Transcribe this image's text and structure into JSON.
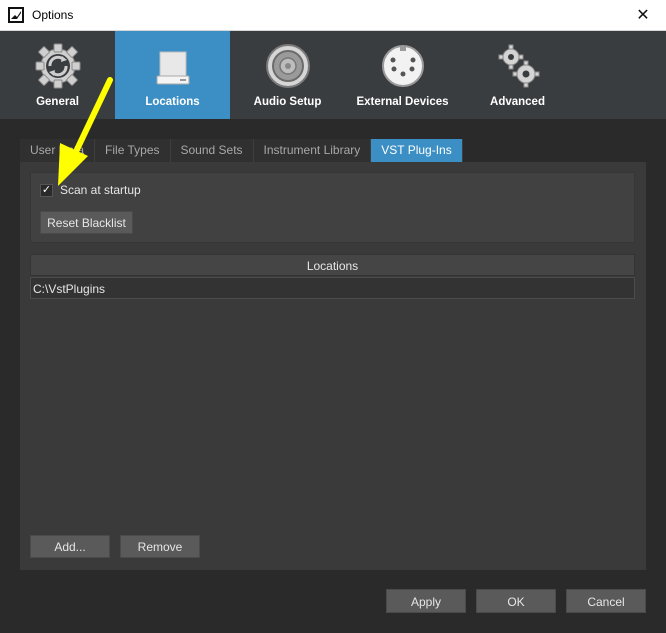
{
  "window": {
    "title": "Options",
    "close_glyph": "✕"
  },
  "categories": [
    {
      "label": "General",
      "icon": "gear-sync-icon"
    },
    {
      "label": "Locations",
      "icon": "drive-icon",
      "active": true
    },
    {
      "label": "Audio Setup",
      "icon": "speaker-icon"
    },
    {
      "label": "External Devices",
      "icon": "midi-connector-icon"
    },
    {
      "label": "Advanced",
      "icon": "gears-icon"
    }
  ],
  "subtabs": [
    {
      "label": "User Data"
    },
    {
      "label": "File Types"
    },
    {
      "label": "Sound Sets"
    },
    {
      "label": "Instrument Library"
    },
    {
      "label": "VST Plug-Ins",
      "active": true
    }
  ],
  "vst": {
    "scan_label": "Scan at startup",
    "scan_checked": true,
    "check_glyph": "✓",
    "reset_blacklist": "Reset Blacklist",
    "locations_header": "Locations",
    "locations": [
      "C:\\VstPlugins"
    ],
    "add": "Add...",
    "remove": "Remove"
  },
  "footer": {
    "apply": "Apply",
    "ok": "OK",
    "cancel": "Cancel"
  },
  "colors": {
    "accent": "#3c8fc5",
    "annotation_arrow": "#ffff00"
  }
}
